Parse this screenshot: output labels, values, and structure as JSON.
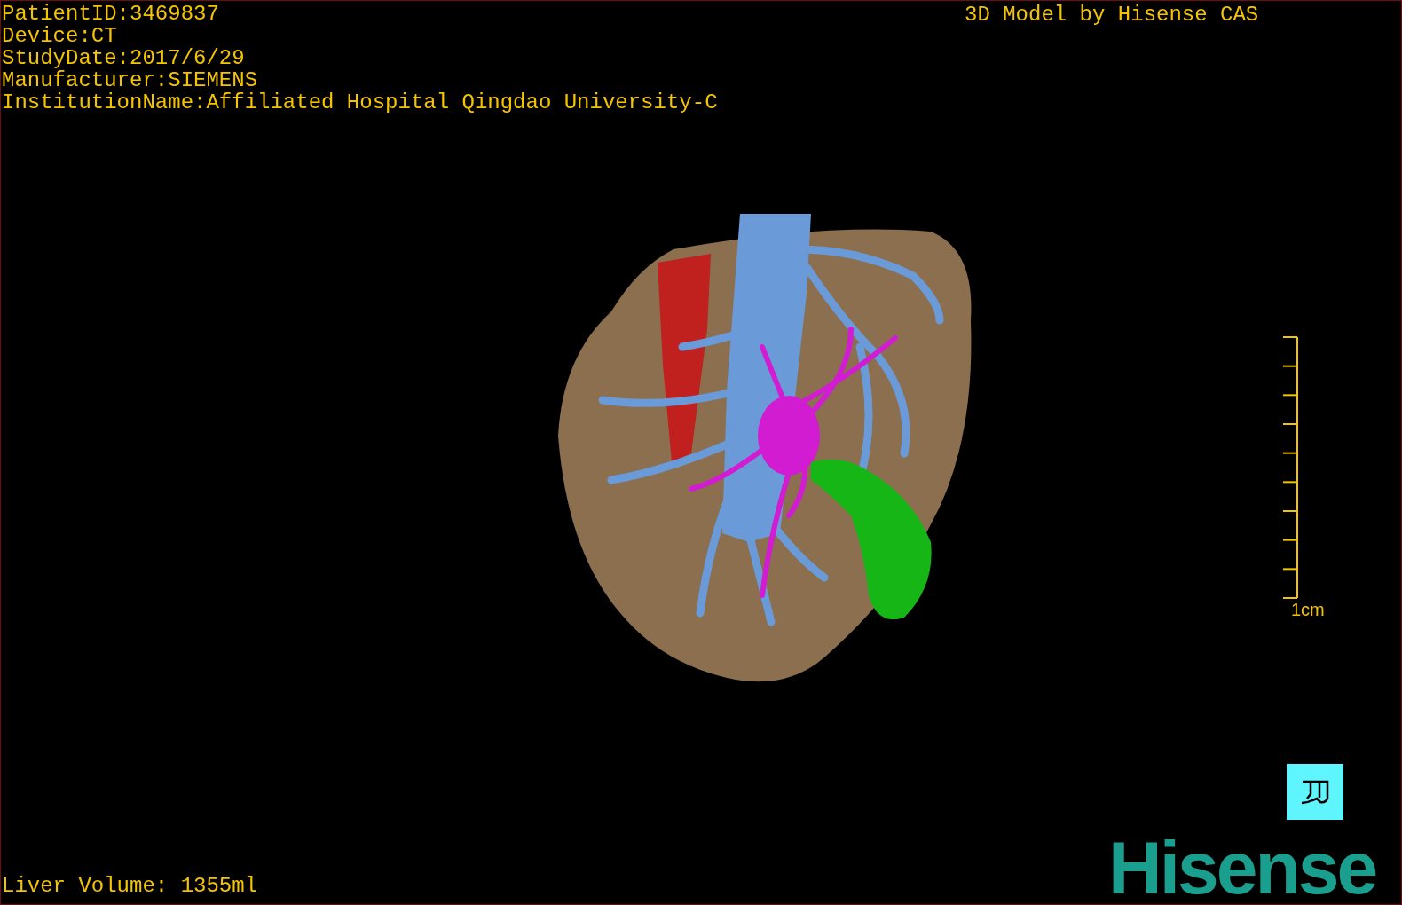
{
  "study_info": [
    "PatientID:3469837",
    "Device:CT",
    "StudyDate:2017/6/29",
    "Manufacturer:SIEMENS",
    "InstitutionName:Affiliated Hospital Qingdao University-C"
  ],
  "model_credit": "3D Model by Hisense CAS",
  "scale_bar": {
    "label": "1cm"
  },
  "liver_volume": "Liver Volume: 1355ml",
  "logo": "Hisense"
}
